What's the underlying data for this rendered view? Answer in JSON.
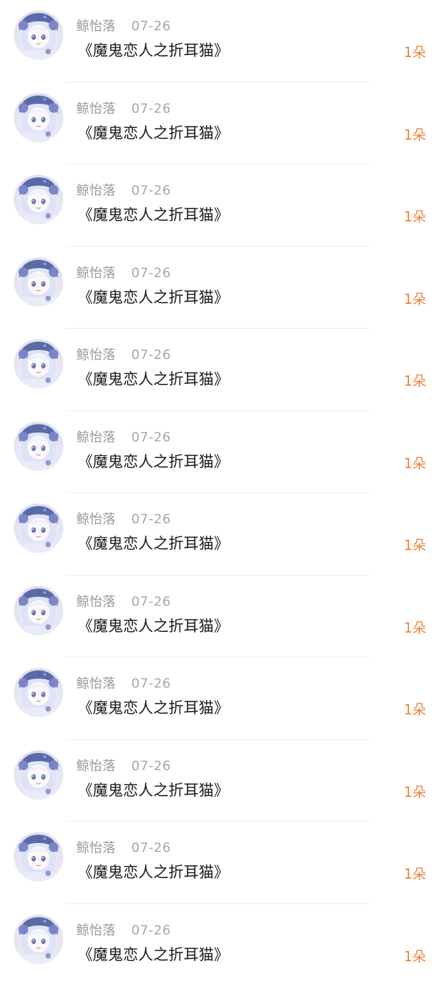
{
  "records": [
    {
      "name": "鲸怡落",
      "date": "07-26",
      "title": "《魔鬼恋人之折耳猫》",
      "gift": "1朵",
      "avatar": "anime-girl-avatar"
    },
    {
      "name": "鲸怡落",
      "date": "07-26",
      "title": "《魔鬼恋人之折耳猫》",
      "gift": "1朵",
      "avatar": "anime-girl-avatar"
    },
    {
      "name": "鲸怡落",
      "date": "07-26",
      "title": "《魔鬼恋人之折耳猫》",
      "gift": "1朵",
      "avatar": "anime-girl-avatar"
    },
    {
      "name": "鲸怡落",
      "date": "07-26",
      "title": "《魔鬼恋人之折耳猫》",
      "gift": "1朵",
      "avatar": "anime-girl-avatar"
    },
    {
      "name": "鲸怡落",
      "date": "07-26",
      "title": "《魔鬼恋人之折耳猫》",
      "gift": "1朵",
      "avatar": "anime-girl-avatar"
    },
    {
      "name": "鲸怡落",
      "date": "07-26",
      "title": "《魔鬼恋人之折耳猫》",
      "gift": "1朵",
      "avatar": "anime-girl-avatar"
    },
    {
      "name": "鲸怡落",
      "date": "07-26",
      "title": "《魔鬼恋人之折耳猫》",
      "gift": "1朵",
      "avatar": "anime-girl-avatar"
    },
    {
      "name": "鲸怡落",
      "date": "07-26",
      "title": "《魔鬼恋人之折耳猫》",
      "gift": "1朵",
      "avatar": "anime-girl-avatar"
    },
    {
      "name": "鲸怡落",
      "date": "07-26",
      "title": "《魔鬼恋人之折耳猫》",
      "gift": "1朵",
      "avatar": "anime-girl-avatar"
    },
    {
      "name": "鲸怡落",
      "date": "07-26",
      "title": "《魔鬼恋人之折耳猫》",
      "gift": "1朵",
      "avatar": "anime-girl-avatar"
    },
    {
      "name": "鲸怡落",
      "date": "07-26",
      "title": "《魔鬼恋人之折耳猫》",
      "gift": "1朵",
      "avatar": "anime-girl-avatar"
    },
    {
      "name": "鲸怡落",
      "date": "07-26",
      "title": "《魔鬼恋人之折耳猫》",
      "gift": "1朵",
      "avatar": "anime-girl-avatar"
    }
  ],
  "colors": {
    "name": "#9a9a9a",
    "date": "#a7a7a7",
    "title": "#1d1d1d",
    "gift": "#f0843f",
    "divider": "#eeeeee",
    "avatar_hair": "#5a6aa8",
    "avatar_accent": "#7b86c9"
  }
}
